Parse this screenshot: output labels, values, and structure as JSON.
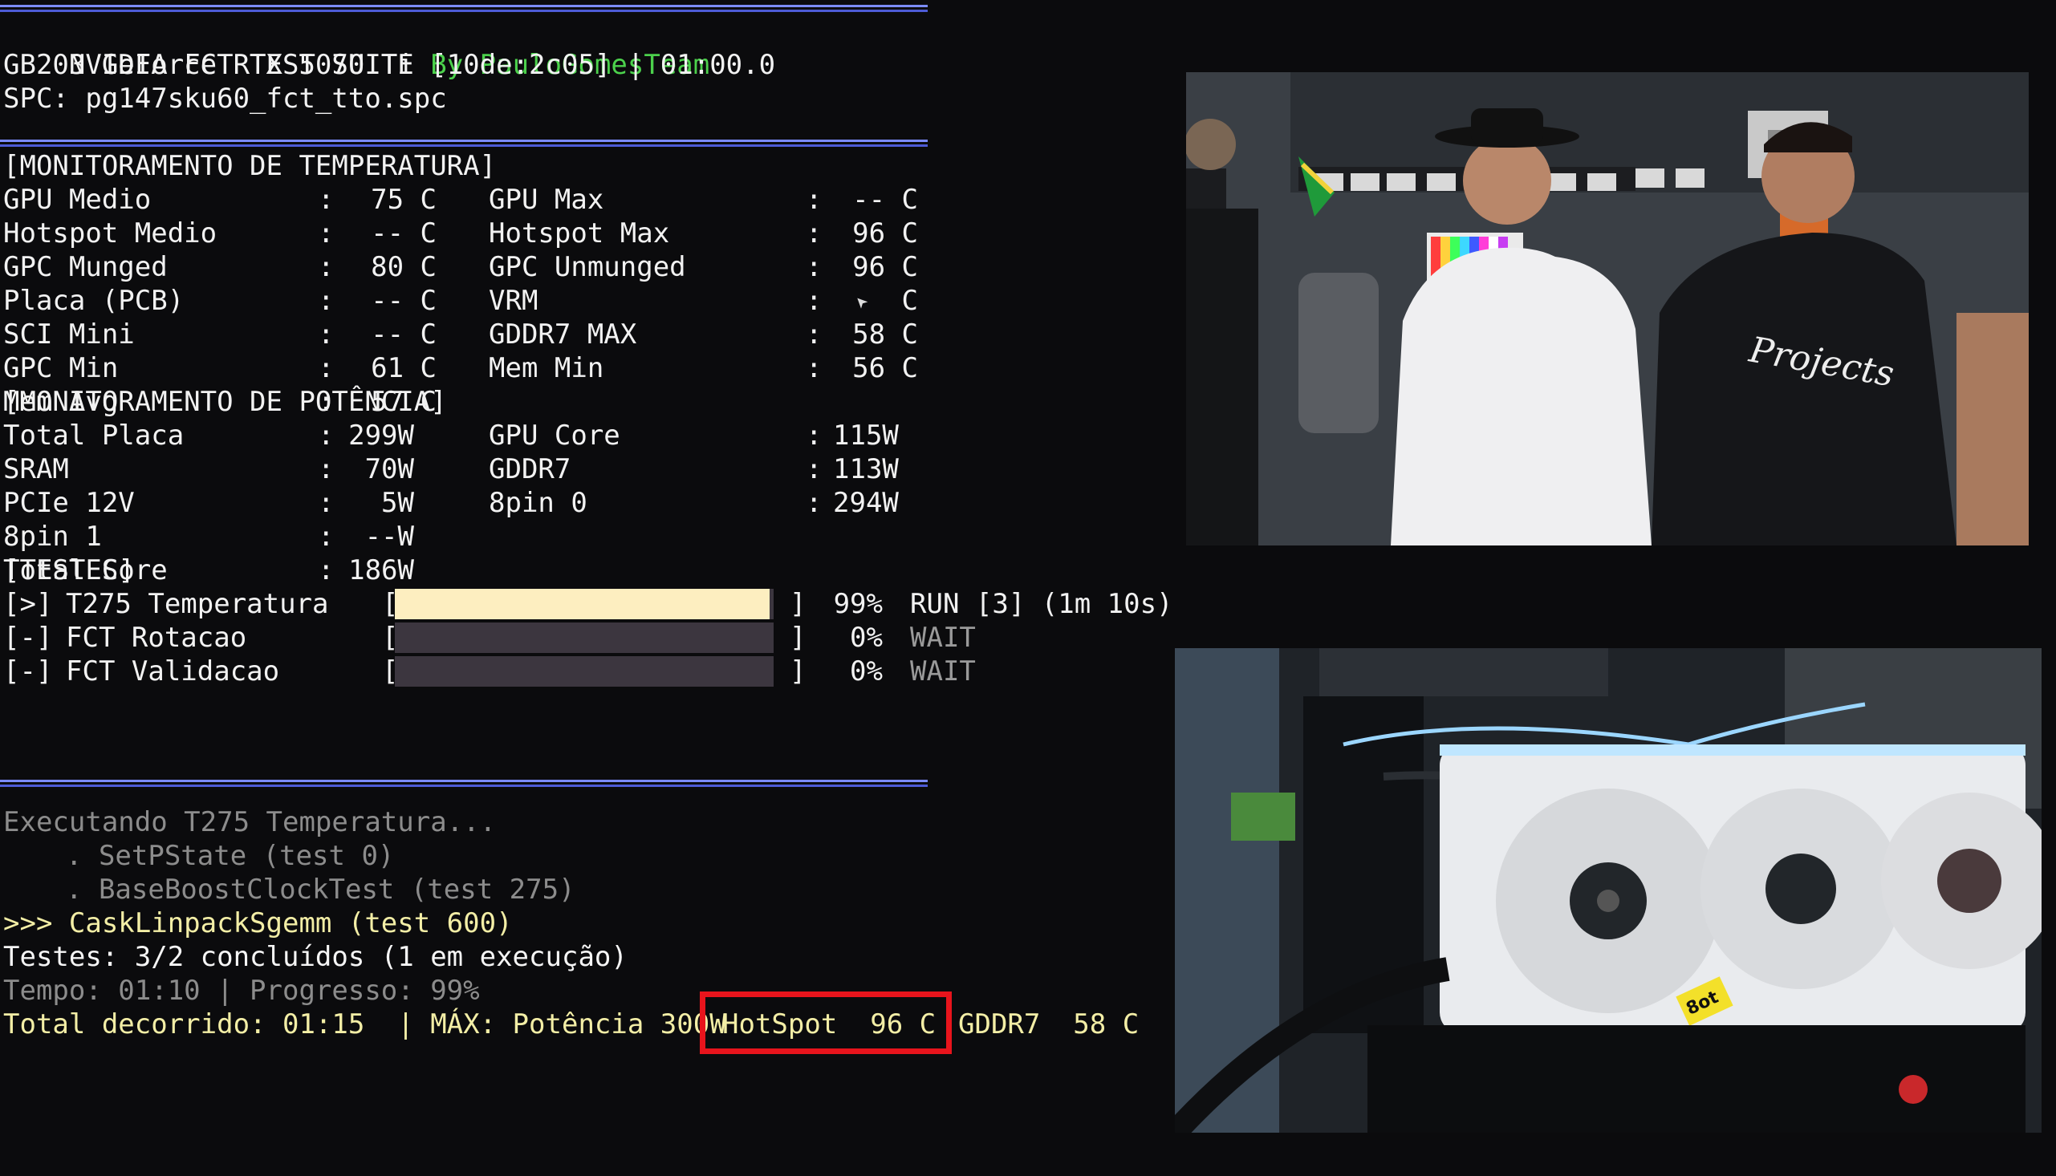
{
  "header": {
    "title": "NVIDIA FCT TEST SUITE",
    "byline": "By PauloGomesTeam",
    "gpu_line": "GB203 GeForce RTX 5070 Ti [10de:2c05] | 01:00.0",
    "spc_line": "SPC: pg147sku60_fct_tto.spc"
  },
  "temperature": {
    "section": "[MONITORAMENTO DE TEMPERATURA]",
    "rows": [
      {
        "l_label": "GPU Medio",
        "l_value": "75 C",
        "r_label": "GPU Max",
        "r_value": "-- C"
      },
      {
        "l_label": "Hotspot Medio",
        "l_value": "-- C",
        "r_label": "Hotspot Max",
        "r_value": "96 C"
      },
      {
        "l_label": "GPC Munged",
        "l_value": "80 C",
        "r_label": "GPC Unmunged",
        "r_value": "96 C"
      },
      {
        "l_label": "Placa (PCB)",
        "l_value": "-- C",
        "r_label": "VRM",
        "r_value": "C"
      },
      {
        "l_label": "SCI Mini",
        "l_value": "-- C",
        "r_label": "GDDR7 MAX",
        "r_value": "58 C"
      },
      {
        "l_label": "GPC Min",
        "l_value": "61 C",
        "r_label": "Mem Min",
        "r_value": "56 C"
      },
      {
        "l_label": "Mem Avg",
        "l_value": "57 C",
        "r_label": "",
        "r_value": ""
      }
    ]
  },
  "power": {
    "section": "[MONITORAMENTO DE POTÊNCIA]",
    "rows": [
      {
        "l_label": "Total Placa",
        "l_value": "299W",
        "r_label": "GPU Core",
        "r_value": "115W"
      },
      {
        "l_label": "SRAM",
        "l_value": "70W",
        "r_label": "GDDR7",
        "r_value": "113W"
      },
      {
        "l_label": "PCIe 12V",
        "l_value": "5W",
        "r_label": "8pin 0",
        "r_value": "294W"
      },
      {
        "l_label": "8pin 1",
        "l_value": "--W",
        "r_label": "",
        "r_value": ""
      },
      {
        "l_label": "Total Core",
        "l_value": "186W",
        "r_label": "",
        "r_value": ""
      }
    ]
  },
  "tests": {
    "section": "[TESTES]",
    "items": [
      {
        "marker": "[>]",
        "name": "T275 Temperatura",
        "progress": 0.99,
        "percent": "99%",
        "status": "RUN [3] (1m 10s)"
      },
      {
        "marker": "[-]",
        "name": "FCT Rotacao",
        "progress": 0,
        "percent": "0%",
        "status": "WAIT"
      },
      {
        "marker": "[-]",
        "name": "FCT Validacao",
        "progress": 0,
        "percent": "0%",
        "status": "WAIT"
      }
    ]
  },
  "log": {
    "executing": "Executando T275 Temperatura...",
    "sub1": ". SetPState (test 0)",
    "sub2": ". BaseBoostClockTest (test 275)",
    "current": ">>> CaskLinpackSgemm (test 600)",
    "summary": "Testes: 3/2 concluídos (1 em execução)",
    "tempo": "Tempo: 01:10 | Progresso: 99%",
    "total_prefix": "Total decorrido: 01:15  | MÁX: Potência 300W",
    "hotspot": "HotSpot  96 C",
    "gddr7": "GDDR7  58 C"
  },
  "colors": {
    "accent_sep": "#7c8cff",
    "green": "#4cd14c",
    "highlight_box": "#e8141c",
    "bar_fill": "#fdeec0",
    "bar_empty": "#3c363f"
  },
  "media": {
    "panel_top": "webcam-people",
    "panel_bottom": "gpu-closeup",
    "sticker_text": "8ot"
  }
}
